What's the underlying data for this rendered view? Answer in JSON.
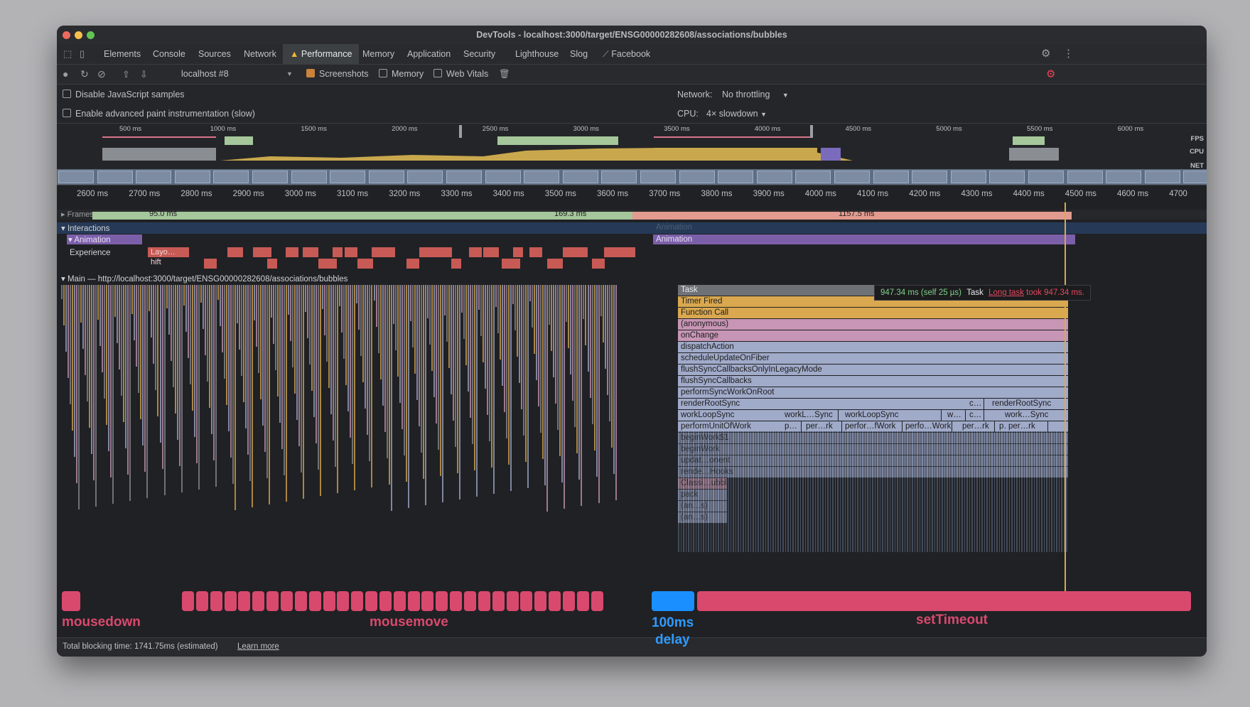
{
  "window": {
    "title": "DevTools - localhost:3000/target/ENSG00000282608/associations/bubbles"
  },
  "tabs": [
    {
      "label": "Elements"
    },
    {
      "label": "Console"
    },
    {
      "label": "Sources"
    },
    {
      "label": "Network"
    },
    {
      "label": "Performance",
      "active": true
    },
    {
      "label": "Memory"
    },
    {
      "label": "Application"
    },
    {
      "label": "Security"
    },
    {
      "label": "Lighthouse"
    },
    {
      "label": "Slog"
    },
    {
      "label": "Facebook"
    }
  ],
  "toolbar": {
    "profile_select": "localhost #8",
    "screenshots_label": "Screenshots",
    "memory_label": "Memory",
    "web_vitals_label": "Web Vitals"
  },
  "settings": {
    "disable_js_samples": "Disable JavaScript samples",
    "advanced_paint": "Enable advanced paint instrumentation (slow)",
    "network_label": "Network:",
    "network_value": "No throttling",
    "cpu_label": "CPU:",
    "cpu_value": "4× slowdown"
  },
  "overview": {
    "ticks": [
      "500 ms",
      "1000 ms",
      "1500 ms",
      "2000 ms",
      "2500 ms",
      "3000 ms",
      "3500 ms",
      "4000 ms",
      "4500 ms",
      "5000 ms",
      "5500 ms",
      "6000 ms"
    ],
    "tracks": [
      "FPS",
      "CPU",
      "NET"
    ]
  },
  "ruler": {
    "ticks": [
      "2600 ms",
      "2700 ms",
      "2800 ms",
      "2900 ms",
      "3000 ms",
      "3100 ms",
      "3200 ms",
      "3300 ms",
      "3400 ms",
      "3500 ms",
      "3600 ms",
      "3700 ms",
      "3800 ms",
      "3900 ms",
      "4000 ms",
      "4100 ms",
      "4200 ms",
      "4300 ms",
      "4400 ms",
      "4500 ms",
      "4600 ms",
      "4700"
    ]
  },
  "tracks": {
    "frames": "Frames",
    "frame_durations": [
      "95.0 ms",
      "169.3 ms",
      "1157.5 ms"
    ],
    "interactions": "Interactions",
    "animation": "Animation",
    "animation_bar": "Animation",
    "animation_faded": "Animation",
    "experience": "Experience",
    "layout_shift": "Layo…hift",
    "main": "Main — http://localhost:3000/target/ENSG00000282608/associations/bubbles"
  },
  "flame_stack": [
    {
      "label": "Task",
      "color": "#8a8d92"
    },
    {
      "label": "Timer Fired",
      "color": "#d9a84f"
    },
    {
      "label": "Function Call",
      "color": "#d9a84f"
    },
    {
      "label": "(anonymous)",
      "color": "#c795b5"
    },
    {
      "label": "onChange",
      "color": "#c795b5"
    },
    {
      "label": "dispatchAction",
      "color": "#a0aac9"
    },
    {
      "label": "scheduleUpdateOnFiber",
      "color": "#a0aac9"
    },
    {
      "label": "flushSyncCallbacksOnlyInLegacyMode",
      "color": "#a0aac9"
    },
    {
      "label": "flushSyncCallbacks",
      "color": "#a0aac9"
    },
    {
      "label": "performSyncWorkOnRoot",
      "color": "#a0aac9"
    },
    {
      "label": "renderRootSync",
      "color": "#a0aac9"
    },
    {
      "label": "workLoopSync",
      "color": "#a0aac9"
    },
    {
      "label": "performUnitOfWork",
      "color": "#a0aac9"
    },
    {
      "label": "beginWork$1",
      "color": "#a0aac9"
    },
    {
      "label": "beginWork",
      "color": "#a0aac9"
    },
    {
      "label": "updat…onent",
      "color": "#a0aac9"
    },
    {
      "label": "rende…Hooks",
      "color": "#a0aac9"
    },
    {
      "label": "Classi…ubbles",
      "color": "#d99ab0"
    },
    {
      "label": "pack",
      "color": "#a0aac9"
    },
    {
      "label": "(an…s)",
      "color": "#a0aac9"
    },
    {
      "label": "(an…s)",
      "color": "#a0aac9"
    }
  ],
  "flame_extra": {
    "renderRootSync_c": "c…",
    "renderRootSync_2": "renderRootSync",
    "workL_sync": "workL…Sync",
    "workLoopSync_2": "workLoopSync",
    "w": "w…",
    "c": "c…",
    "work_sync": "work…Sync",
    "p": "p…",
    "per_rk": "per…rk",
    "perfor_fwork": "perfor…fWork",
    "perfo_work": "perfo…Work",
    "per_rk_2": "per…rk",
    "p_2": "p…",
    "per_rk_3": "per…rk"
  },
  "tooltip": {
    "duration": "947.34 ms (self 25 µs)",
    "name": "Task",
    "link": "Long task",
    "suffix": "took 947.34 ms."
  },
  "annotations": {
    "mousedown": "mousedown",
    "mousemove": "mousemove",
    "delay_line1": "100ms",
    "delay_line2": "delay",
    "settimeout": "setTimeout"
  },
  "colors": {
    "event_pink": "#d9496e",
    "delay_blue": "#1a8fff",
    "annotation_blue": "#2f9bff"
  },
  "status": {
    "blocking_time": "Total blocking time: 1741.75ms (estimated)",
    "learn_more": "Learn more"
  }
}
